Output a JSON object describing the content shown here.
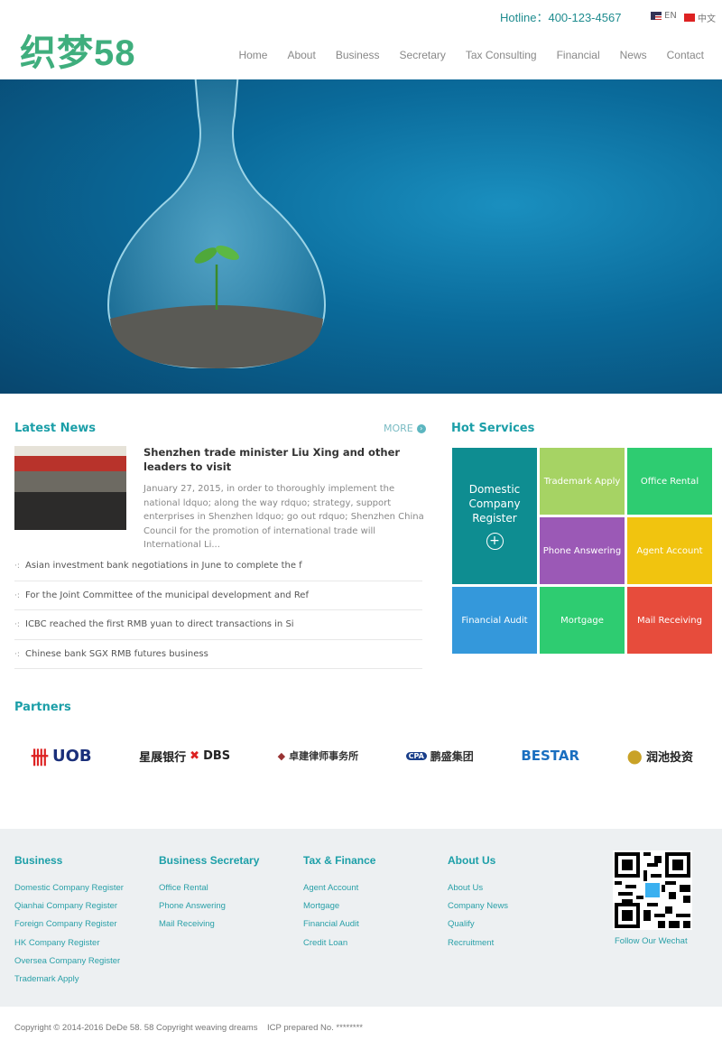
{
  "header": {
    "logo_text": "织梦58",
    "hotline": "Hotline：400-123-4567",
    "languages": [
      {
        "label": "EN",
        "flag": "us-flag"
      },
      {
        "label": "中文",
        "flag": "cn-flag"
      }
    ],
    "nav": [
      "Home",
      "About",
      "Business",
      "Secretary",
      "Tax Consulting",
      "Financial",
      "News",
      "Contact"
    ]
  },
  "hero": {
    "slides": 2,
    "active_slide": 1
  },
  "latest_news": {
    "title": "Latest News",
    "more": "MORE",
    "featured": {
      "title": "Shenzhen trade minister Liu Xing and other leaders to visit",
      "excerpt": "January 27, 2015, in order to thoroughly implement the national ldquo; along the way rdquo; strategy, support enterprises in Shenzhen ldquo; go out rdquo; Shenzhen China Council for the promotion of international trade will International Li..."
    },
    "items": [
      "Asian investment bank negotiations in June to complete the f",
      "For the Joint Committee of the municipal development and Ref",
      "ICBC reached the first RMB yuan to direct transactions in Si",
      "Chinese bank SGX RMB futures business"
    ]
  },
  "hot_services": {
    "title": "Hot Services",
    "tiles": [
      {
        "label": "Domestic Company Register",
        "color": "#0e8d91"
      },
      {
        "label": "Trademark Apply",
        "color": "#a6d364"
      },
      {
        "label": "Office Rental",
        "color": "#2ecc71"
      },
      {
        "label": "Phone Answering",
        "color": "#9b59b6"
      },
      {
        "label": "Agent Account",
        "color": "#f1c40f"
      },
      {
        "label": "Financial Audit",
        "color": "#3498db"
      },
      {
        "label": "Mortgage",
        "color": "#2ecc71"
      },
      {
        "label": "Mail Receiving",
        "color": "#e74c3c"
      }
    ]
  },
  "partners": {
    "title": "Partners",
    "logos": [
      "UOB 大華銀行",
      "星展银行 DBS",
      "卓建律师事务所 ZHUO JIAN LAW FIRM",
      "CPA 鹏盛集团",
      "BESTAR One World. One Service Center.",
      "润池投资 Run Chi Investment"
    ]
  },
  "footer": {
    "columns": [
      {
        "title": "Business",
        "links": [
          "Domestic Company Register",
          "Qianhai Company Register",
          "Foreign Company Register",
          "HK Company Register",
          "Oversea Company Register",
          "Trademark Apply"
        ]
      },
      {
        "title": "Business Secretary",
        "links": [
          "Office Rental",
          "Phone Answering",
          "Mail Receiving"
        ]
      },
      {
        "title": "Tax & Finance",
        "links": [
          "Agent Account",
          "Mortgage",
          "Financial Audit",
          "Credit Loan"
        ]
      },
      {
        "title": "About Us",
        "links": [
          "About Us",
          "Company News",
          "Qualify",
          "Recruitment"
        ]
      }
    ],
    "wechat": "Follow Our Wechat",
    "copyright": "Copyright © 2014-2016 DeDe 58. 58 Copyright weaving dreams",
    "icp": "ICP prepared No. ********"
  },
  "colors": {
    "accent": "#1c9fa8",
    "logo": "#3fae7d",
    "footer_bg": "#edf0f2"
  }
}
